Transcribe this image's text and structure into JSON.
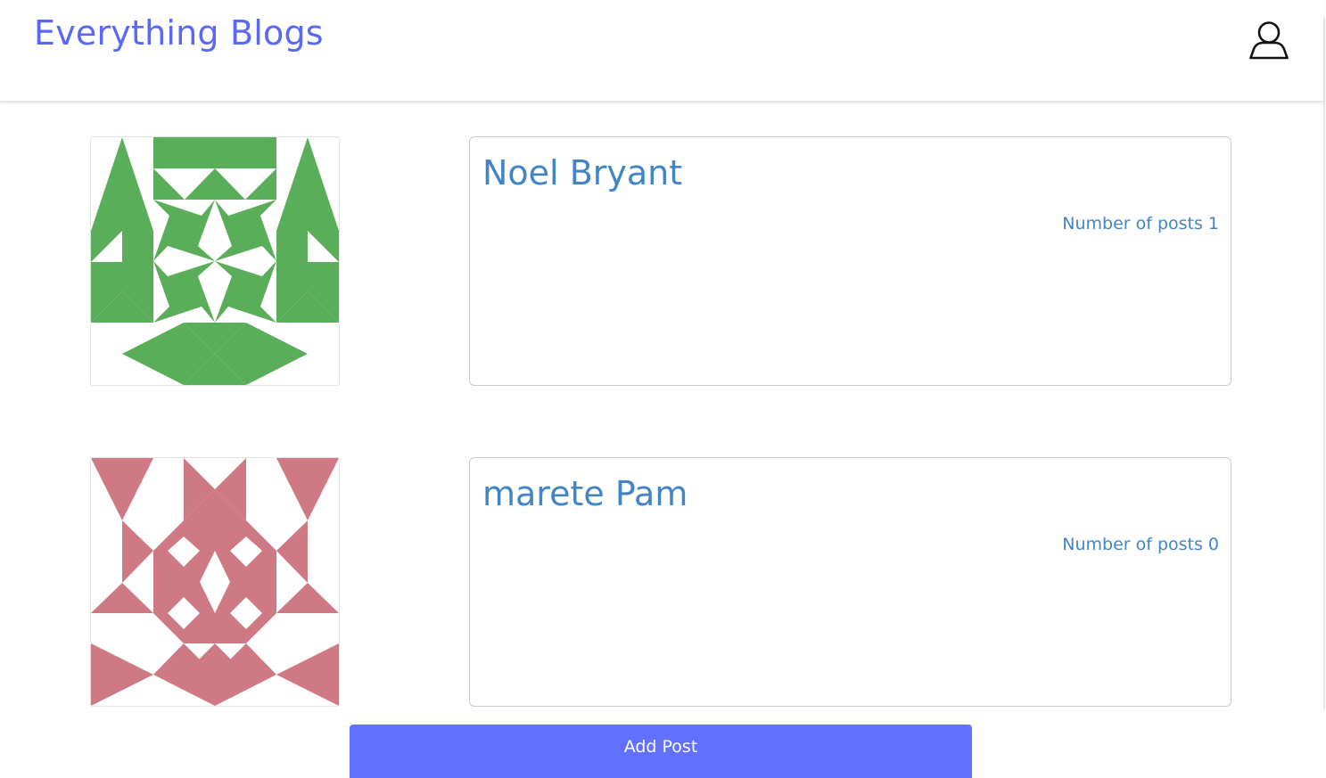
{
  "app": {
    "title": "Everything Blogs",
    "brand_color": "#5b67f5",
    "accent_color": "#4285c6",
    "button_color": "#6170ff"
  },
  "header": {
    "user_icon": "user-profile-icon"
  },
  "authors": [
    {
      "name": "Noel Bryant",
      "posts_label": "Number of posts",
      "posts_count": "1",
      "avatar_icon": "identicon-green",
      "avatar_color": "#5aae5a"
    },
    {
      "name": "marete Pam",
      "posts_label": "Number of posts",
      "posts_count": "0",
      "avatar_icon": "identicon-pink",
      "avatar_color": "#cf7985"
    }
  ],
  "actions": {
    "add_post_label": "Add Post"
  }
}
